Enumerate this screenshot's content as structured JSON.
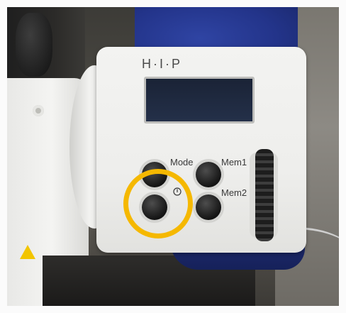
{
  "device": {
    "logo": "H·I·P",
    "buttons": {
      "mode_label": "Mode",
      "mem1_label": "Mem1",
      "mem2_label": "Mem2"
    },
    "highlighted_button": "power-button",
    "highlight_color": "#f5b800",
    "display_color": "#1f2a40"
  }
}
